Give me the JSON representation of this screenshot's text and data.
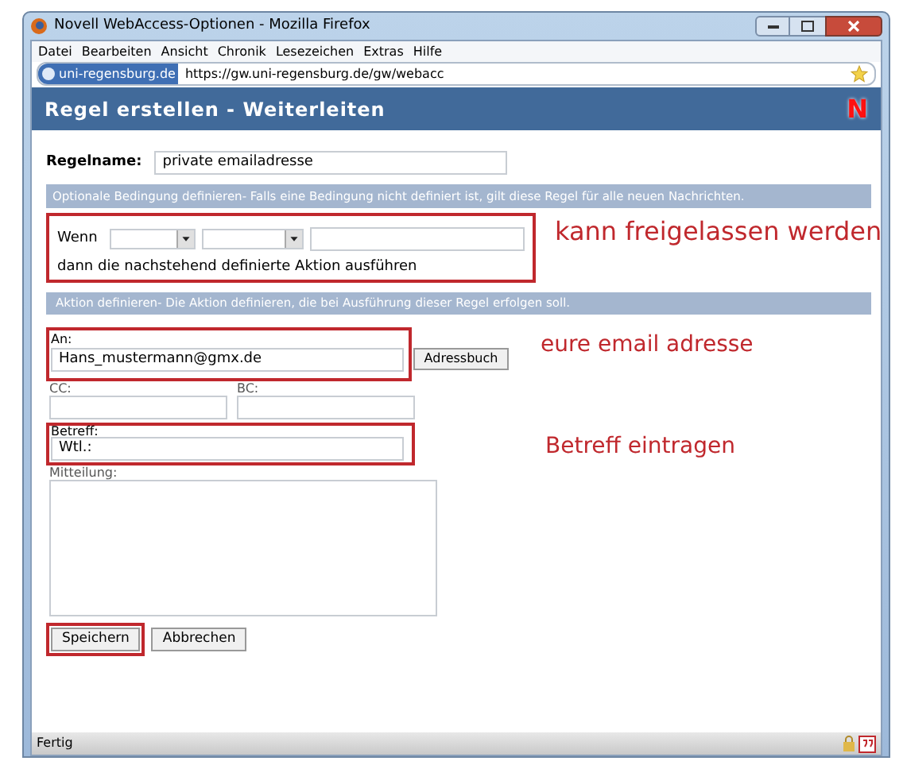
{
  "window": {
    "title": "Novell WebAccess-Optionen - Mozilla Firefox"
  },
  "menu": [
    "Datei",
    "Bearbeiten",
    "Ansicht",
    "Chronik",
    "Lesezeichen",
    "Extras",
    "Hilfe"
  ],
  "address_bar": {
    "site": "uni-regensburg.de",
    "url": "https://gw.uni-regensburg.de/gw/webacc"
  },
  "page_header": {
    "title": "Regel erstellen - Weiterleiten",
    "logo": "N"
  },
  "rule_name": {
    "label": "Regelname:",
    "value": "private emailadresse"
  },
  "condition": {
    "heading": "Optionale Bedingung definieren- Falls eine Bedingung nicht definiert ist, gilt diese Regel für alle neuen Nachrichten.",
    "if_label": "Wenn",
    "sentence": "dann die nachstehend definierte Aktion ausführen",
    "highlighted": true,
    "annotation": "kann freigelassen werden"
  },
  "action": {
    "heading": "Aktion definieren- Die Aktion definieren, die bei Ausführung dieser Regel erfolgen soll."
  },
  "to": {
    "label": "An:",
    "value": "Hans_mustermann@gmx.de",
    "button": "Adressbuch",
    "highlighted": true,
    "annotation": "eure email adresse"
  },
  "cc": {
    "label": "CC:"
  },
  "bc": {
    "label": "BC:"
  },
  "subject": {
    "label": "Betreff:",
    "value": "Wtl.:",
    "highlighted": true,
    "annotation": "Betreff eintragen"
  },
  "message": {
    "label": "Mitteilung:"
  },
  "buttons": [
    {
      "label": "Speichern",
      "highlighted": true
    },
    {
      "label": "Abbrechen",
      "highlighted": false
    }
  ],
  "status_bar": {
    "text": "Fertig"
  }
}
